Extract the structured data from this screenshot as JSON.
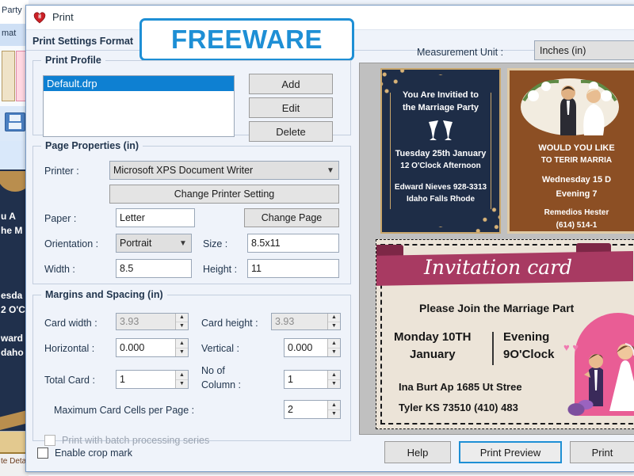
{
  "background_app": {
    "tab_label": "Party",
    "ribbon_label": "mat",
    "preview_lines": [
      "u A",
      "he M",
      "esda",
      "2 O'C",
      "ward",
      "daho"
    ],
    "footer_label": "te Deta"
  },
  "dialog": {
    "title": "Print",
    "icon": "heart-icon",
    "tab_label": "Print Settings Format",
    "badge": "FREEWARE",
    "badge_color": "#1e8fd5"
  },
  "print_profile": {
    "legend": "Print Profile",
    "items": [
      "Default.drp"
    ],
    "selected": "Default.drp",
    "buttons": {
      "add": "Add",
      "edit": "Edit",
      "delete": "Delete"
    }
  },
  "page_properties": {
    "legend": "Page Properties  (in)",
    "printer_label": "Printer :",
    "printer_value": "Microsoft XPS Document Writer",
    "change_printer_setting": "Change Printer Setting",
    "paper_label": "Paper :",
    "paper_value": "Letter",
    "change_page": "Change Page",
    "orientation_label": "Orientation :",
    "orientation_value": "Portrait",
    "size_label": "Size :",
    "size_value": "8.5x11",
    "width_label": "Width :",
    "width_value": "8.5",
    "height_label": "Height :",
    "height_value": "11"
  },
  "margins_spacing": {
    "legend": "Margins and Spacing  (in)",
    "card_width_label": "Card width :",
    "card_width_value": "3.93",
    "card_height_label": "Card height :",
    "card_height_value": "3.93",
    "horizontal_label": "Horizontal :",
    "horizontal_value": "0.000",
    "vertical_label": "Vertical :",
    "vertical_value": "0.000",
    "total_card_label": "Total Card :",
    "total_card_value": "1",
    "no_of_column_label_l1": "No of",
    "no_of_column_label_l2": "Column :",
    "no_of_column_value": "1",
    "max_cells_label": "Maximum Card Cells per Page :",
    "max_cells_value": "2"
  },
  "checkboxes": {
    "batch_label": "Print with batch processing series",
    "batch_checked": false,
    "crop_label": "Enable crop mark",
    "crop_checked": false
  },
  "measurement": {
    "label": "Measurement Unit :",
    "value": "Inches (in)"
  },
  "preview_cards": {
    "card1": {
      "line1": "You Are Invitied to",
      "line2": "the Marriage  Party",
      "line3": "Tuesday 25th January",
      "line4": "12 O'Clock Afternoon",
      "line5": "Edward Nieves 928-3313",
      "line6": "Idaho Falls Rhode"
    },
    "card2": {
      "line1": "WOULD YOU LIKE",
      "line2": "TO TERIR MARRIA",
      "line3": "Wednesday 15 D",
      "line4": "Evening 7",
      "line5": "Remedios Hester",
      "line6": "(614) 514-1"
    },
    "card3": {
      "ribbon": "Invitation card",
      "heading": "Please Join the Marriage Part",
      "date_l1": "Monday 10TH",
      "date_l2": "January",
      "time_l1": "Evening",
      "time_l2": "9O'Clock",
      "addr_l1": "Ina Burt Ap 1685 Ut Stree",
      "addr_l2": "Tyler KS 73510 (410) 483"
    }
  },
  "footer_buttons": {
    "help": "Help",
    "print_preview": "Print Preview",
    "print": "Print"
  }
}
